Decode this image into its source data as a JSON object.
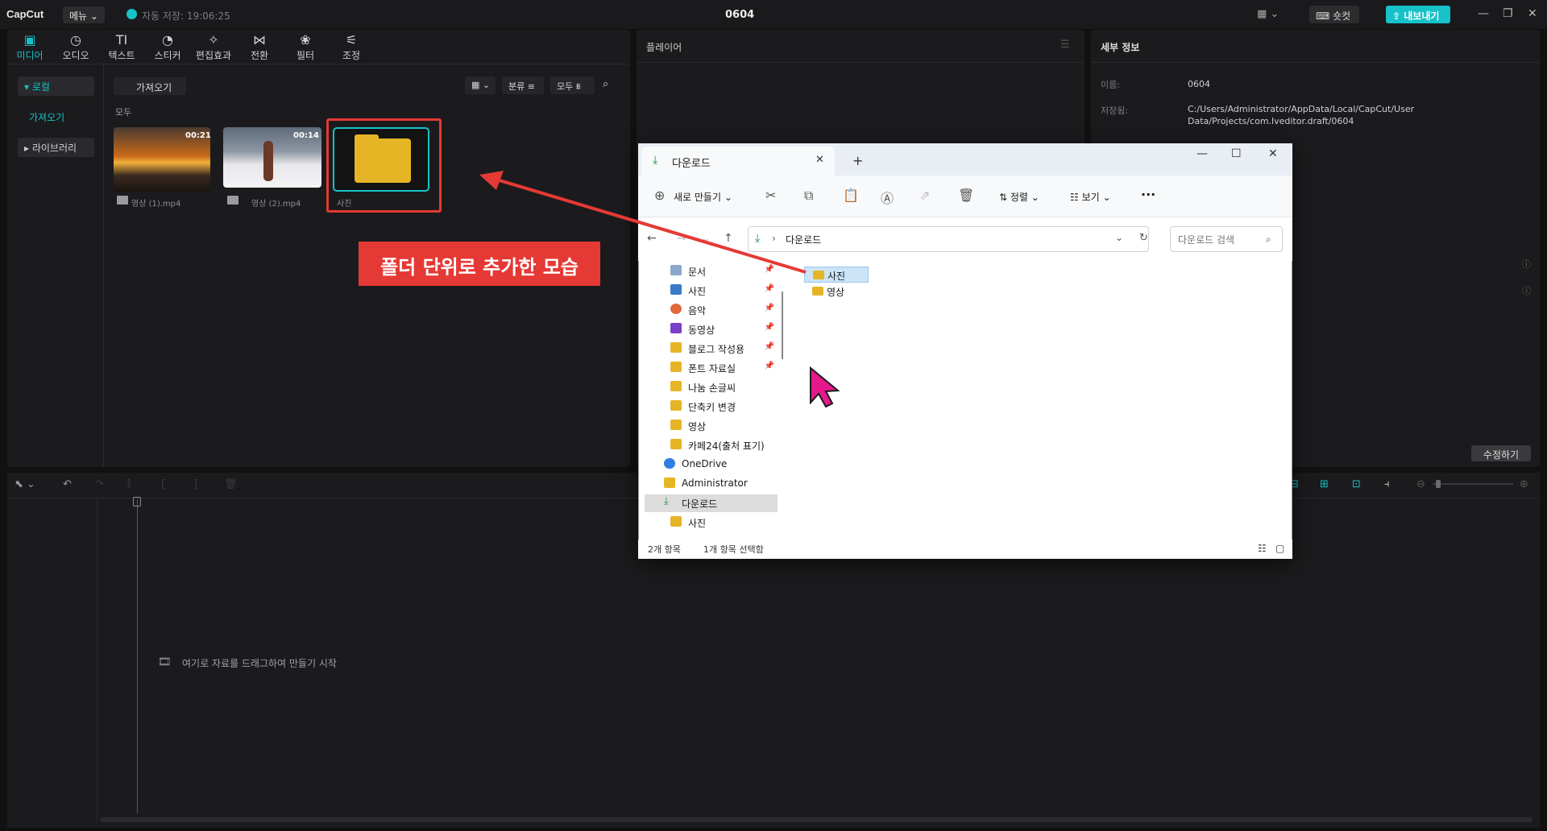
{
  "app": {
    "logo": "CapCut",
    "menu_label": "메뉴",
    "autosave": "자동 저장: 19:06:25",
    "project_title": "0604",
    "shortcut_label": "숏컷",
    "export_label": "내보내기"
  },
  "media_tabs": [
    {
      "icon": "media-icon",
      "label": "미디어"
    },
    {
      "icon": "audio-icon",
      "label": "오디오"
    },
    {
      "icon": "text-icon",
      "label": "텍스트"
    },
    {
      "icon": "sticker-icon",
      "label": "스티커"
    },
    {
      "icon": "effects-icon",
      "label": "편집효과"
    },
    {
      "icon": "transition-icon",
      "label": "전환"
    },
    {
      "icon": "filter-icon",
      "label": "필터"
    },
    {
      "icon": "adjust-icon",
      "label": "조정"
    }
  ],
  "media_sidebar": {
    "local": "로컬",
    "import": "가져오기",
    "library": "라이브러리"
  },
  "media_toolbar": {
    "import_label": "가져오기",
    "sort_label": "분류",
    "all_label": "모두",
    "section_all": "모두"
  },
  "media_items": [
    {
      "name": "영상 (1).mp4",
      "duration": "00:21"
    },
    {
      "name": "영상 (2).mp4",
      "duration": "00:14"
    },
    {
      "name": "사진",
      "duration": ""
    }
  ],
  "annotation": {
    "label": "폴더 단위로 추가한 모습",
    "color": "#e53935"
  },
  "player": {
    "title": "플레이어"
  },
  "details": {
    "title": "세부 정보",
    "name_label": "이름:",
    "name_value": "0604",
    "saved_label": "저장됨:",
    "saved_value": "C:/Users/Administrator/AppData/Local/CapCut/User Data/Projects/com.lveditor.draft/0604",
    "modify_label": "수정하기"
  },
  "timeline": {
    "drop_hint": "여기로 자료를 드래그하여 만들기 시작"
  },
  "explorer": {
    "tab_title": "다운로드",
    "new_label": "새로 만들기",
    "sort_label": "정렬",
    "view_label": "보기",
    "address": "다운로드",
    "search_placeholder": "다운로드 검색",
    "nav_items": [
      {
        "label": "문서",
        "icon": "document-icon",
        "pinned": true
      },
      {
        "label": "사진",
        "icon": "pictures-icon",
        "pinned": true
      },
      {
        "label": "음악",
        "icon": "music-icon",
        "pinned": true
      },
      {
        "label": "동영상",
        "icon": "video-icon",
        "pinned": true
      },
      {
        "label": "블로그 작성용",
        "icon": "folder-icon",
        "pinned": true
      },
      {
        "label": "폰트 자료실",
        "icon": "folder-icon",
        "pinned": true
      },
      {
        "label": "나눔 손글씨",
        "icon": "folder-icon",
        "pinned": false
      },
      {
        "label": "단축키 변경",
        "icon": "folder-icon",
        "pinned": false
      },
      {
        "label": "영상",
        "icon": "folder-icon",
        "pinned": false
      },
      {
        "label": "카페24(출처 표기)",
        "icon": "folder-icon",
        "pinned": false
      },
      {
        "label": "OneDrive",
        "icon": "cloud-icon",
        "pinned": false
      },
      {
        "label": "Administrator",
        "icon": "folder-icon",
        "pinned": false
      },
      {
        "label": "다운로드",
        "icon": "download-icon",
        "pinned": false
      },
      {
        "label": "사진",
        "icon": "folder-icon",
        "pinned": false
      }
    ],
    "files": [
      "사진",
      "영상"
    ],
    "status_count": "2개 항목",
    "status_selected": "1개 항목 선택함"
  },
  "colors": {
    "accent": "#16c2c8",
    "annotation_red": "#e53935",
    "cursor_magenta": "#e6198c",
    "folder_yellow": "#e6b526"
  }
}
